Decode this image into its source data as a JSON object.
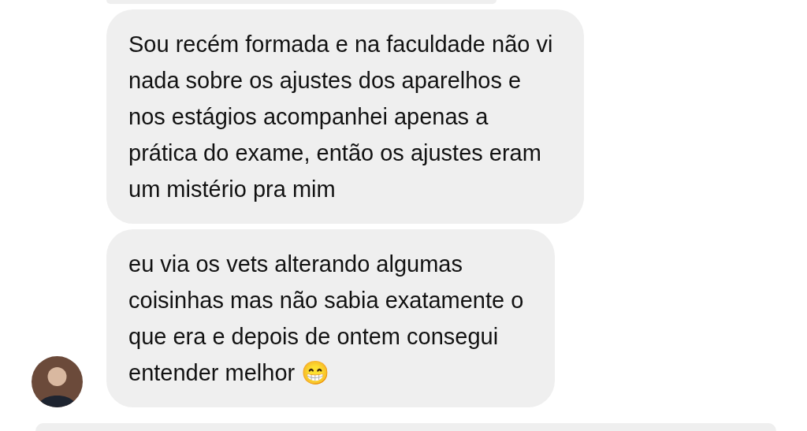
{
  "messages": [
    {
      "kind": "partial"
    },
    {
      "kind": "text",
      "show_avatar": false,
      "text": "Sou recém formada e na faculdade não vi\nnada sobre os ajustes dos aparelhos e\nnos estágios acompanhei apenas a\nprática do exame, então os ajustes eram\num mistério pra mim"
    },
    {
      "kind": "text",
      "show_avatar": true,
      "text": "eu via os vets alterando algumas\ncoisinhas mas não sabia exatamente o\nque era e depois de ontem consegui\nentender melhor 😁"
    },
    {
      "kind": "partial"
    }
  ]
}
